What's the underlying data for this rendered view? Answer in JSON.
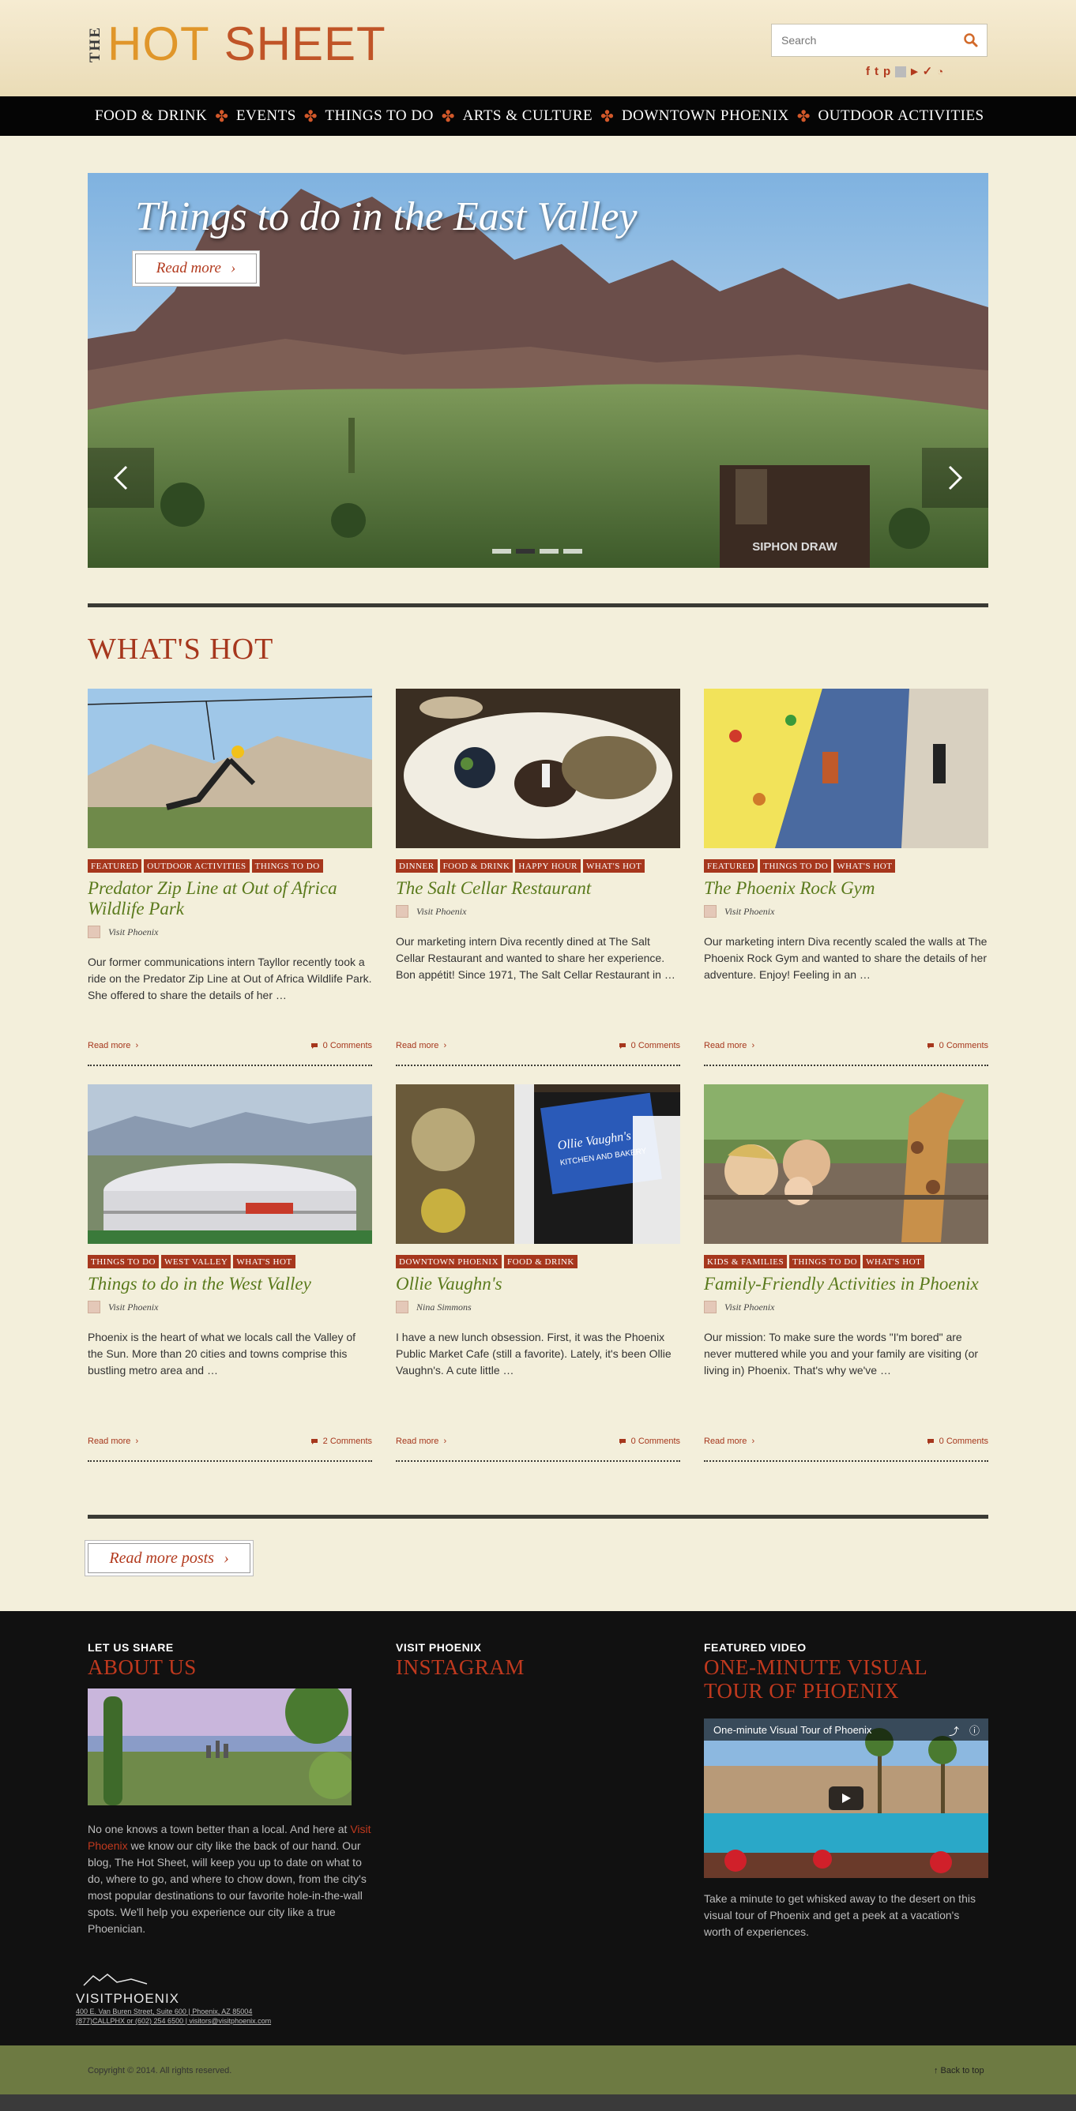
{
  "header": {
    "logo_the": "THE",
    "logo_hot": "HOT",
    "logo_sheet": "SHEET",
    "search_placeholder": "Search",
    "social_icons": [
      "facebook-icon",
      "twitter-icon",
      "pinterest-icon",
      "flickr-icon",
      "youtube-icon",
      "foursquare-icon",
      "rss-icon"
    ]
  },
  "nav": {
    "items": [
      "FOOD & DRINK",
      "EVENTS",
      "THINGS TO DO",
      "ARTS & CULTURE",
      "DOWNTOWN PHOENIX",
      "OUTDOOR ACTIVITIES"
    ],
    "separator": "✤"
  },
  "hero": {
    "title": "Things to do in the East Valley",
    "button": "Read more",
    "sign_text": "SIPHON DRAW",
    "slide_count": 4,
    "active_slide": 2
  },
  "section": {
    "title": "WHAT'S HOT"
  },
  "posts": [
    {
      "tags": [
        "FEATURED",
        "OUTDOOR ACTIVITIES",
        "THINGS TO DO"
      ],
      "title": "Predator Zip Line at Out of Africa Wildlife Park",
      "author": "Visit Phoenix",
      "excerpt": "Our former communications intern Tayllor recently took a ride on the Predator Zip Line at Out of Africa Wildlife Park. She offered to share the details of her …",
      "read_more": "Read more",
      "comments": "0 Comments"
    },
    {
      "tags": [
        "DINNER",
        "FOOD & DRINK",
        "HAPPY HOUR",
        "WHAT'S HOT"
      ],
      "title": "The Salt Cellar Restaurant",
      "author": "Visit Phoenix",
      "excerpt": "Our marketing intern Diva recently dined at The Salt Cellar Restaurant and wanted to share her experience. Bon appétit! Since 1971, The Salt Cellar Restaurant in …",
      "read_more": "Read more",
      "comments": "0 Comments"
    },
    {
      "tags": [
        "FEATURED",
        "THINGS TO DO",
        "WHAT'S HOT"
      ],
      "title": "The Phoenix Rock Gym",
      "author": "Visit Phoenix",
      "excerpt": "Our marketing intern Diva recently scaled the walls at The Phoenix Rock Gym and wanted to share the details of her adventure. Enjoy! Feeling in an …",
      "read_more": "Read more",
      "comments": "0 Comments"
    },
    {
      "tags": [
        "THINGS TO DO",
        "WEST VALLEY",
        "WHAT'S HOT"
      ],
      "title": "Things to do in the West Valley",
      "author": "Visit Phoenix",
      "excerpt": "Phoenix is the heart of what we locals call the Valley of the Sun. More than 20 cities and towns comprise this bustling metro area and …",
      "read_more": "Read more",
      "comments": "2 Comments"
    },
    {
      "tags": [
        "DOWNTOWN PHOENIX",
        "FOOD & DRINK"
      ],
      "title": "Ollie Vaughn's",
      "author": "Nina Simmons",
      "excerpt": "  I have a new lunch obsession. First, it was the Phoenix Public Market Cafe (still a favorite). Lately, it's been Ollie Vaughn's. A cute little …",
      "read_more": "Read more",
      "comments": "0 Comments",
      "thumb_label": "Ollie Vaughn's KITCHEN AND BAKERY"
    },
    {
      "tags": [
        "KIDS & FAMILIES",
        "THINGS TO DO",
        "WHAT'S HOT"
      ],
      "title": "Family-Friendly Activities in Phoenix",
      "author": "Visit Phoenix",
      "excerpt": "Our mission: To make sure the words \"I'm bored\" are never muttered while you and your family are visiting (or living in) Phoenix. That's why we've …",
      "read_more": "Read more",
      "comments": "0 Comments"
    }
  ],
  "more_posts": "Read more posts",
  "footer": {
    "about": {
      "kicker": "LET US SHARE",
      "heading": "ABOUT US",
      "text_before": "No one knows a town better than a local. And here at ",
      "link": "Visit Phoenix",
      "text_after": " we know our city like the back of our hand. Our blog, The Hot Sheet, will keep you up to date on what to do, where to go, and where to chow down, from the city's most popular destinations to our favorite hole-in-the-wall spots. We'll help you experience our city like a true Phoenician."
    },
    "instagram": {
      "kicker": "VISIT PHOENIX",
      "heading": "INSTAGRAM"
    },
    "video": {
      "kicker": "FEATURED VIDEO",
      "heading": "ONE-MINUTE VISUAL TOUR OF PHOENIX",
      "video_title": "One-minute Visual Tour of Phoenix",
      "text": "Take a minute to get whisked away to the desert on this visual tour of Phoenix and get a peek at a vacation's worth of experiences."
    },
    "logo_name": "VISITPHOENIX",
    "address": "400 E. Van Buren Street, Suite 600 | Phoenix, AZ 85004",
    "contact": "(877)CALLPHX or (602) 254 6500 | visitors@visitphoenix.com"
  },
  "bottom": {
    "copyright": "Copyright © 2014. All rights reserved.",
    "back_to_top": "↑ Back to top"
  },
  "colors": {
    "accent": "#a6371d",
    "title_green": "#5a7a1c",
    "nav_bg": "#050505",
    "page_bg": "#f3efdb",
    "footer_bg": "#111111",
    "bottom_bar": "#6d7a42"
  }
}
